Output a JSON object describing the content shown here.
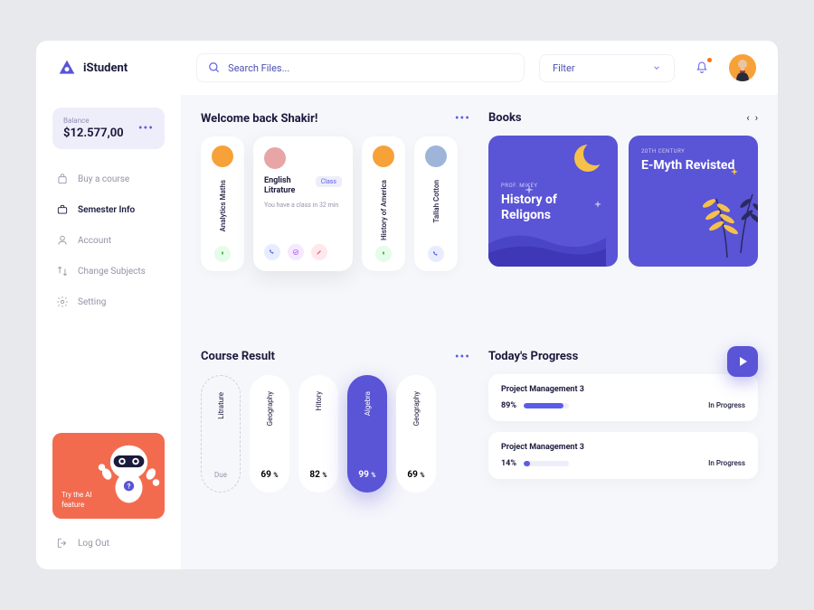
{
  "brand": "iStudent",
  "search": {
    "placeholder": "Search Files..."
  },
  "filter": {
    "label": "Filter"
  },
  "sidebar": {
    "balance": {
      "label": "Balance",
      "value": "$12.577,00"
    },
    "items": [
      {
        "label": "Buy a course"
      },
      {
        "label": "Semester Info"
      },
      {
        "label": "Account"
      },
      {
        "label": "Change Subjects"
      },
      {
        "label": "Setting"
      }
    ],
    "ai": {
      "text": "Try the AI feature"
    },
    "logout": "Log Out"
  },
  "welcome": {
    "title": "Welcome back Shakir!",
    "cards": [
      {
        "label": "Analytics Maths",
        "avatar": "#f7a139"
      },
      {
        "label": "English Litrature",
        "badge": "Class",
        "subtitle": "You have a class in 32 min",
        "avatar": "#e8a5a5",
        "wide": true
      },
      {
        "label": "History of America",
        "avatar": "#f7a139"
      },
      {
        "label": "Tallah Cotton",
        "avatar": "#9eb5d9"
      }
    ]
  },
  "books": {
    "title": "Books",
    "items": [
      {
        "tag": "PROF. MIKEY",
        "title": "History of Religons"
      },
      {
        "tag": "20TH CENTURY",
        "title": "E-Myth Revisted"
      }
    ]
  },
  "results": {
    "title": "Course Result",
    "items": [
      {
        "label": "Litrature",
        "value": "Due",
        "dashed": true
      },
      {
        "label": "Geography",
        "value": "69",
        "unit": "%"
      },
      {
        "label": "Hitory",
        "value": "82",
        "unit": "%"
      },
      {
        "label": "Algebra",
        "value": "99",
        "unit": "%",
        "active": true
      },
      {
        "label": "Geography",
        "value": "69",
        "unit": "%"
      }
    ]
  },
  "progress": {
    "title": "Today's Progress",
    "items": [
      {
        "title": "Project Management 3",
        "percent": "89%",
        "fill": 89,
        "status": "In Progress"
      },
      {
        "title": "Project Management 3",
        "percent": "14%",
        "fill": 14,
        "status": "In Progress"
      }
    ]
  }
}
